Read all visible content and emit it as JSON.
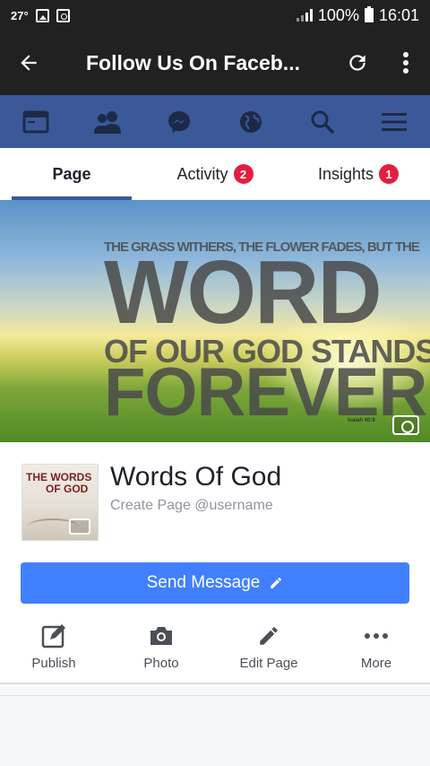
{
  "status_bar": {
    "temperature": "27°",
    "battery": "100%",
    "time": "16:01"
  },
  "app_bar": {
    "title": "Follow Us On Faceb...",
    "back_icon": "arrow-left-icon",
    "refresh_icon": "refresh-icon",
    "more_icon": "more-vertical-icon"
  },
  "fb_nav": {
    "items": [
      "news-feed-icon",
      "friends-icon",
      "messenger-icon",
      "globe-icon",
      "search-icon",
      "menu-icon"
    ]
  },
  "tabs": [
    {
      "label": "Page",
      "badge": ""
    },
    {
      "label": "Activity",
      "badge": "2"
    },
    {
      "label": "Insights",
      "badge": "1"
    }
  ],
  "cover": {
    "line1": "THE GRASS WITHERS, THE FLOWER FADES, BUT THE",
    "line2": "WORD",
    "line3": "OF OUR GOD STANDS",
    "line4": "FOREVER",
    "reference": "Isaiah 40:8"
  },
  "page": {
    "name": "Words Of God",
    "username_prompt": "Create Page @username",
    "profile_text_1": "THE WORDS",
    "profile_text_2": "OF GOD"
  },
  "send_button": {
    "label": "Send Message"
  },
  "actions": [
    {
      "label": "Publish",
      "icon": "publish-icon"
    },
    {
      "label": "Photo",
      "icon": "camera-icon"
    },
    {
      "label": "Edit Page",
      "icon": "pencil-icon"
    },
    {
      "label": "More",
      "icon": "more-horizontal-icon"
    }
  ],
  "colors": {
    "fb_blue": "#3b5998",
    "button_blue": "#4080ff",
    "badge_red": "#e41e3f",
    "dark_bar": "#212121"
  }
}
